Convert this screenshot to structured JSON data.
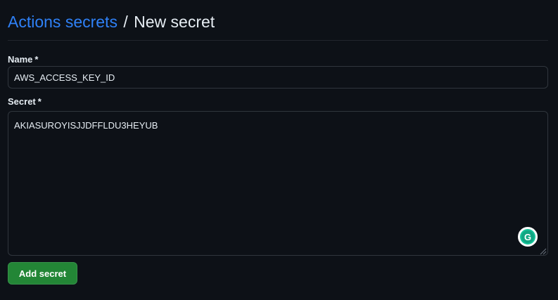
{
  "header": {
    "breadcrumb_link": "Actions secrets",
    "separator": "/",
    "current": "New secret"
  },
  "form": {
    "name_label": "Name",
    "name_required": "*",
    "name_value": "AWS_ACCESS_KEY_ID",
    "secret_label": "Secret",
    "secret_required": "*",
    "secret_value": "AKIASUROYISJJDFFLDU3HEYUB",
    "submit_label": "Add secret"
  },
  "icons": {
    "grammarly": "grammarly-icon",
    "resize": "resize-handle-icon",
    "grammarly_glyph": "G"
  },
  "colors": {
    "background": "#0d1117",
    "link": "#2f81f7",
    "button": "#238636",
    "border": "#30363d",
    "grammarly": "#15c39a"
  }
}
